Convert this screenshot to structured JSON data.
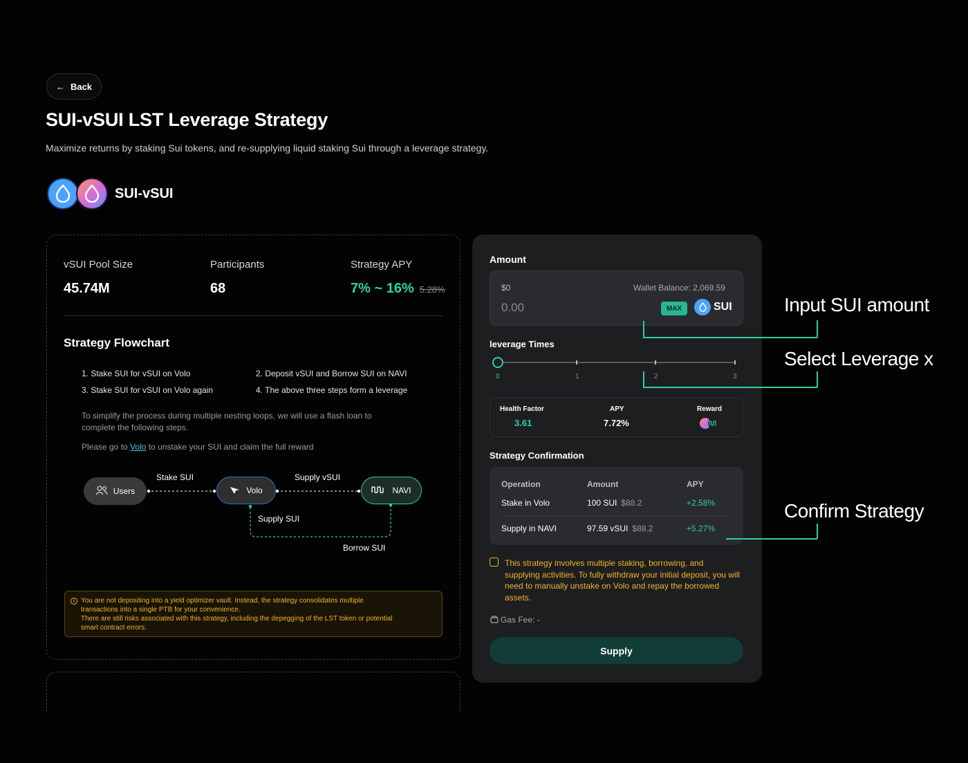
{
  "header": {
    "back_label": "Back",
    "title": "SUI-vSUI LST Leverage Strategy",
    "subtitle": "Maximize returns by staking Sui tokens, and re-supplying liquid staking Sui through a leverage strategy.",
    "pair_name": "SUI-vSUI"
  },
  "stats": {
    "pool_size_label": "vSUI Pool Size",
    "pool_size_value": "45.74M",
    "participants_label": "Participants",
    "participants_value": "68",
    "apy_label": "Strategy APY",
    "apy_value": "7% ~ 16%",
    "apy_old": "5.28%"
  },
  "flowchart": {
    "title": "Strategy Flowchart",
    "steps": [
      "1. Stake SUI for vSUI on Volo",
      "2. Deposit vSUI and Borrow SUI on NAVI",
      "3. Stake SUI for vSUI on Volo again",
      "4. The above three steps form a leverage"
    ],
    "hint1_line1": "To simplify the process during multiple nesting loops, we will use a flash loan to",
    "hint1_line2": "complete the following steps.",
    "hint2_prefix": "Please go to",
    "hint2_link": "Volo",
    "hint2_suffix": "to unstake your SUI and claim the full reward",
    "nodes": {
      "users": "Users",
      "volo": "Volo",
      "navi": "NAVI"
    },
    "edges": {
      "stake_sui": "Stake SUI",
      "supply_vsui": "Supply vSUI",
      "supply_sui": "Supply SUI",
      "borrow_sui": "Borrow SUI"
    }
  },
  "warning": {
    "line1": "You are not depositing into a yield optimizer vault. Instead, the strategy consolidates multiple",
    "line2": "transactions into a single PTB for your convenience.",
    "line3": "There are still risks associated with this strategy, including the depegging of the LST token or potential",
    "line4": "smart contract errors."
  },
  "panel": {
    "amount_label": "Amount",
    "amount_usd": "$0",
    "wallet_balance": "Wallet Balance: 2,069.59",
    "amount_placeholder": "0.00",
    "max_label": "MAX",
    "token": "SUI",
    "leverage_label": "leverage Times",
    "leverage_ticks": [
      "0",
      "1",
      "2",
      "3"
    ],
    "leverage_selected": 0,
    "health_factor_label": "Health Factor",
    "health_factor_value": "3.61",
    "apy_label": "APY",
    "apy_value": "7.72%",
    "reward_label": "Reward",
    "confirmation_title": "Strategy Confirmation",
    "table": {
      "headers": [
        "Operation",
        "Amount",
        "APY"
      ],
      "rows": [
        {
          "operation": "Stake in Volo",
          "amount": "100 SUI",
          "usd": "$88.2",
          "apy": "+2.58%"
        },
        {
          "operation": "Supply in NAVI",
          "amount": "97.59 vSUI",
          "usd": "$88.2",
          "apy": "+5.27%"
        }
      ]
    },
    "disclaimer": "This strategy involves multiple staking, borrowing, and supplying activities. To fully withdraw your initial deposit, you will need to manually unstake on Volo and repay the borrowed assets.",
    "gas_fee": "Gas Fee: -",
    "supply_label": "Supply"
  },
  "annotations": {
    "input": "Input SUI amount",
    "leverage": "Select Leverage x",
    "confirm": "Confirm Strategy"
  },
  "colors": {
    "accent": "#2ecfa7",
    "warning": "#f0b429",
    "link": "#35c8e0",
    "sui_blue": "#4da2ff"
  }
}
